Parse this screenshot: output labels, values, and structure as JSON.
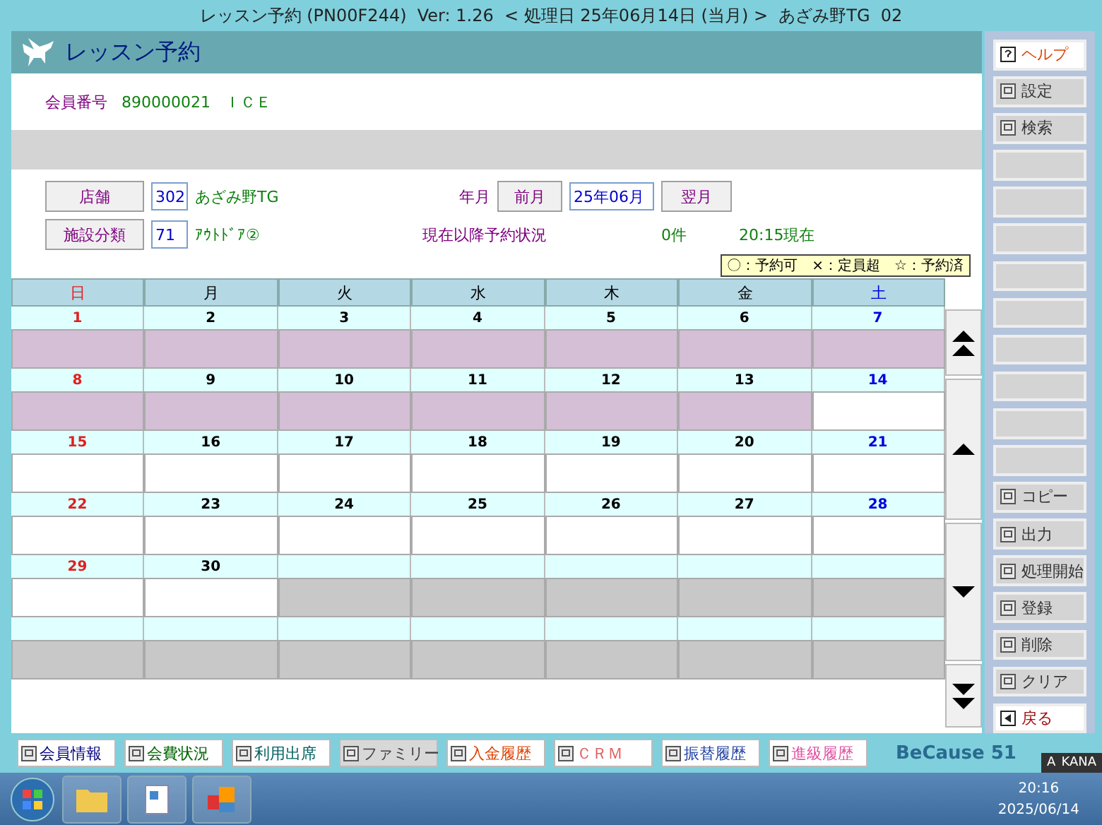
{
  "window": {
    "title": "レッスン予約 (PN00F244)  Ver: 1.26  < 処理日 25年06月14日 (当月) >  あざみ野TG  02"
  },
  "header": {
    "title": "レッスン予約"
  },
  "member": {
    "label": "会員番号",
    "number": "890000021",
    "name": "ＩＣＥ"
  },
  "filters": {
    "store_button": "店舗",
    "store_code": "302",
    "store_name": "あざみ野TG",
    "facility_button": "施設分類",
    "facility_code": "71",
    "facility_name": "ｱｳﾄﾄﾞｱ②",
    "month_label": "年月",
    "prev_button": "前月",
    "month_value": "25年06月",
    "next_button": "翌月",
    "status_label": "現在以降予約状況",
    "status_count": "0件",
    "status_time": "20:15現在",
    "legend": "〇：予約可　×：定員超　☆：予約済"
  },
  "calendar": {
    "weekdays": [
      "日",
      "月",
      "火",
      "水",
      "木",
      "金",
      "土"
    ],
    "weeks": [
      [
        {
          "day": "1",
          "kind": "past"
        },
        {
          "day": "2",
          "kind": "past"
        },
        {
          "day": "3",
          "kind": "past"
        },
        {
          "day": "4",
          "kind": "past"
        },
        {
          "day": "5",
          "kind": "past"
        },
        {
          "day": "6",
          "kind": "past"
        },
        {
          "day": "7",
          "kind": "past"
        }
      ],
      [
        {
          "day": "8",
          "kind": "past"
        },
        {
          "day": "9",
          "kind": "past"
        },
        {
          "day": "10",
          "kind": "past"
        },
        {
          "day": "11",
          "kind": "past"
        },
        {
          "day": "12",
          "kind": "past"
        },
        {
          "day": "13",
          "kind": "past"
        },
        {
          "day": "14",
          "kind": "open"
        }
      ],
      [
        {
          "day": "15",
          "kind": "open"
        },
        {
          "day": "16",
          "kind": "open"
        },
        {
          "day": "17",
          "kind": "open"
        },
        {
          "day": "18",
          "kind": "open"
        },
        {
          "day": "19",
          "kind": "open"
        },
        {
          "day": "20",
          "kind": "open"
        },
        {
          "day": "21",
          "kind": "open"
        }
      ],
      [
        {
          "day": "22",
          "kind": "open"
        },
        {
          "day": "23",
          "kind": "open"
        },
        {
          "day": "24",
          "kind": "open"
        },
        {
          "day": "25",
          "kind": "open"
        },
        {
          "day": "26",
          "kind": "open"
        },
        {
          "day": "27",
          "kind": "open"
        },
        {
          "day": "28",
          "kind": "open"
        }
      ],
      [
        {
          "day": "29",
          "kind": "open"
        },
        {
          "day": "30",
          "kind": "open"
        },
        {
          "kind": "none"
        },
        {
          "kind": "none"
        },
        {
          "kind": "none"
        },
        {
          "kind": "none"
        },
        {
          "kind": "none"
        }
      ],
      [
        {
          "kind": "none"
        },
        {
          "kind": "none"
        },
        {
          "kind": "none"
        },
        {
          "kind": "none"
        },
        {
          "kind": "none"
        },
        {
          "kind": "none"
        },
        {
          "kind": "none"
        }
      ]
    ]
  },
  "side_buttons": [
    {
      "label": "ヘルプ",
      "kind": "help"
    },
    {
      "label": "設定",
      "kind": "normal"
    },
    {
      "label": "検索",
      "kind": "normal"
    },
    {
      "kind": "blank"
    },
    {
      "kind": "blank"
    },
    {
      "kind": "blank"
    },
    {
      "kind": "blank"
    },
    {
      "kind": "blank"
    },
    {
      "kind": "blank"
    },
    {
      "kind": "blank"
    },
    {
      "kind": "blank"
    },
    {
      "kind": "blank"
    },
    {
      "label": "コピー",
      "kind": "normal"
    },
    {
      "label": "出力",
      "kind": "normal"
    },
    {
      "label": "処理開始",
      "kind": "normal"
    },
    {
      "label": "登録",
      "kind": "normal"
    },
    {
      "label": "削除",
      "kind": "normal"
    },
    {
      "label": "クリア",
      "kind": "normal"
    },
    {
      "label": "戻る",
      "kind": "back"
    }
  ],
  "bottom_buttons": [
    {
      "label": "会員情報",
      "color": "#000080",
      "disabled": false
    },
    {
      "label": "会費状況",
      "color": "#006400",
      "disabled": false
    },
    {
      "label": "利用出席",
      "color": "#006060",
      "disabled": false
    },
    {
      "label": "ファミリー",
      "color": "#404040",
      "disabled": true
    },
    {
      "label": "入金履歴",
      "color": "#e04000",
      "disabled": false
    },
    {
      "label": "ＣＲＭ",
      "color": "#e06060",
      "disabled": false
    },
    {
      "label": "振替履歴",
      "color": "#2040a0",
      "disabled": false
    },
    {
      "label": "進級履歴",
      "color": "#e050a0",
      "disabled": false
    }
  ],
  "brand": "BeCause 51",
  "ime_bar": {
    "letter": "A",
    "mode": "KANA"
  },
  "taskbar": {
    "time": "20:16",
    "date": "2025/06/14"
  }
}
